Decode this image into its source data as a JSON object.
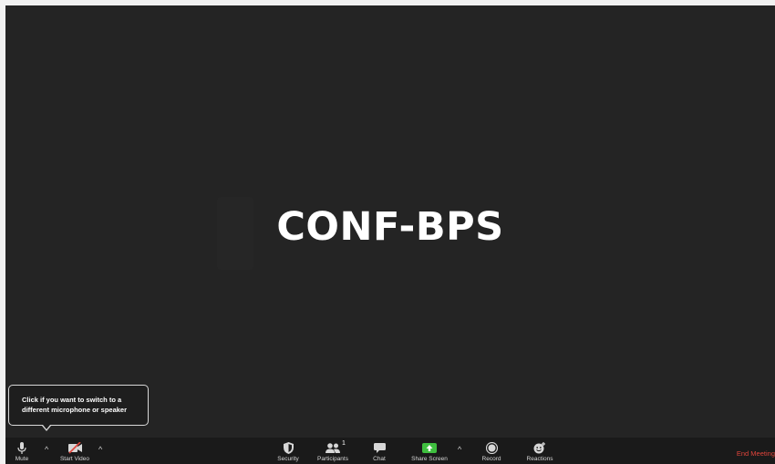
{
  "meeting": {
    "name": "CONF-BPS"
  },
  "tooltip": {
    "line1": "Click if you want to switch to a",
    "line2": "different microphone or speaker"
  },
  "toolbar": {
    "mute": {
      "label": "Mute",
      "icon": "microphone-icon"
    },
    "start_video": {
      "label": "Start Video",
      "icon": "video-off-icon"
    },
    "security": {
      "label": "Security",
      "icon": "shield-icon"
    },
    "participants": {
      "label": "Participants",
      "icon": "people-icon",
      "count": "1"
    },
    "chat": {
      "label": "Chat",
      "icon": "chat-bubble-icon"
    },
    "share_screen": {
      "label": "Share Screen",
      "icon": "share-screen-icon",
      "accent": "#3fbf3f"
    },
    "record": {
      "label": "Record",
      "icon": "record-icon"
    },
    "reactions": {
      "label": "Reactions",
      "icon": "emoji-icon"
    },
    "end_meeting": {
      "label": "End Meeting",
      "color": "#e0443b"
    },
    "caret": "^"
  }
}
